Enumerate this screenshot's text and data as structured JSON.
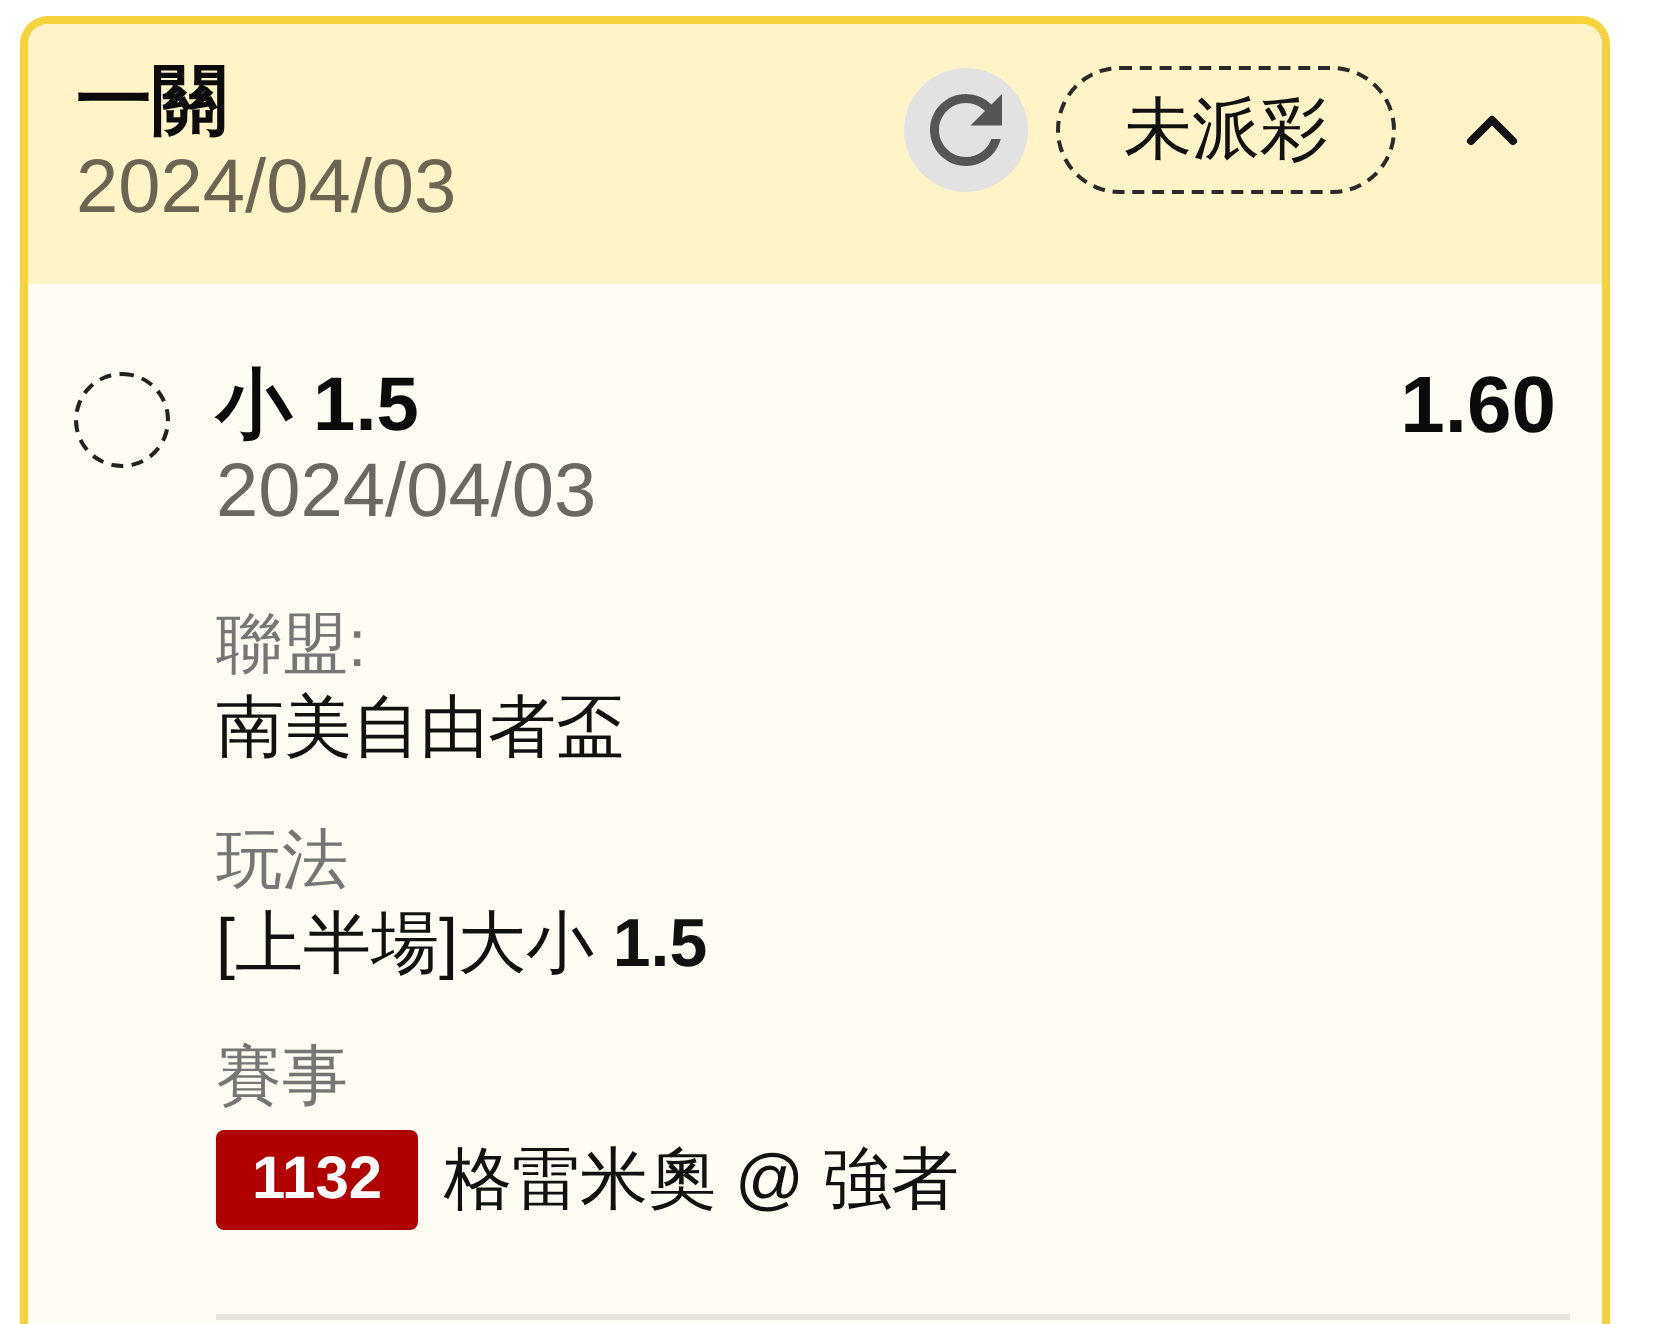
{
  "bet": {
    "title": "一關",
    "date": "2024/04/03",
    "status": "未派彩",
    "expanded": true
  },
  "selections": [
    {
      "selected": false,
      "name": "小 1.5",
      "odds": "1.60",
      "date": "2024/04/03",
      "details": [
        {
          "kind": "text",
          "label": "聯盟:",
          "value": "南美自由者盃"
        },
        {
          "kind": "text",
          "label": "玩法",
          "value": "[上半場]大小 **1.5**"
        },
        {
          "kind": "match",
          "label": "賽事",
          "badge": "1132",
          "value": "格雷米奧 @ 強者"
        }
      ]
    }
  ]
}
